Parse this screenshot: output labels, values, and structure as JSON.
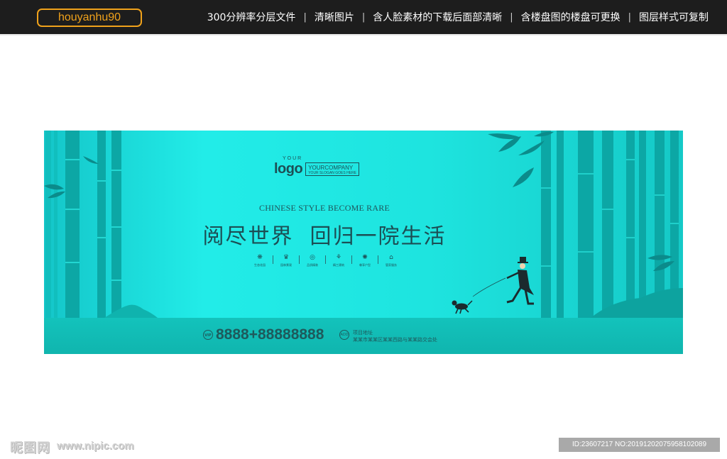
{
  "header": {
    "username": "houyanhu90",
    "features": [
      "300分辨率分层文件",
      "清晰图片",
      "含人脸素材的下载后面部清晰",
      "含楼盘图的楼盘可更换",
      "图层样式可复制"
    ],
    "separator": "|"
  },
  "banner": {
    "logo": {
      "small": "YOUR",
      "word": "logo",
      "company": "YOURCOMPANY",
      "slogan": "YOUR SLOGAN GOES HERE"
    },
    "tagline_en": "CHINESE STYLE BECOME RARE",
    "headline": "阅尽世界  回归一院生活",
    "icons": [
      {
        "icon": "flower-icon",
        "glyph": "❋",
        "label": "生态花园"
      },
      {
        "icon": "lotus-icon",
        "glyph": "♛",
        "label": "园林景观"
      },
      {
        "icon": "circle-icon",
        "glyph": "◎",
        "label": "品质精装"
      },
      {
        "icon": "tree-icon",
        "glyph": "⚘",
        "label": "精工建筑"
      },
      {
        "icon": "medal-icon",
        "glyph": "✺",
        "label": "尊享户型"
      },
      {
        "icon": "house-icon",
        "glyph": "⌂",
        "label": "管家服务"
      }
    ],
    "contact": {
      "vip_label": "VIP",
      "phone": "8888+88888888",
      "address_icon_label": "ADD",
      "address_title": "项目地址",
      "address": "某某市某某区某某西路与某某路交会处"
    }
  },
  "watermark": {
    "brand": "昵图网",
    "site": "www.nipic.com",
    "id_line": "ID:23607217 NO:20191202075958102089"
  },
  "colors": {
    "topbar": "#1d1d1d",
    "accent_orange": "#f0a21b",
    "banner_teal": "#1ee4df",
    "bamboo_dark": "#0c9e9c",
    "text_dark_teal": "#1c4e54"
  }
}
